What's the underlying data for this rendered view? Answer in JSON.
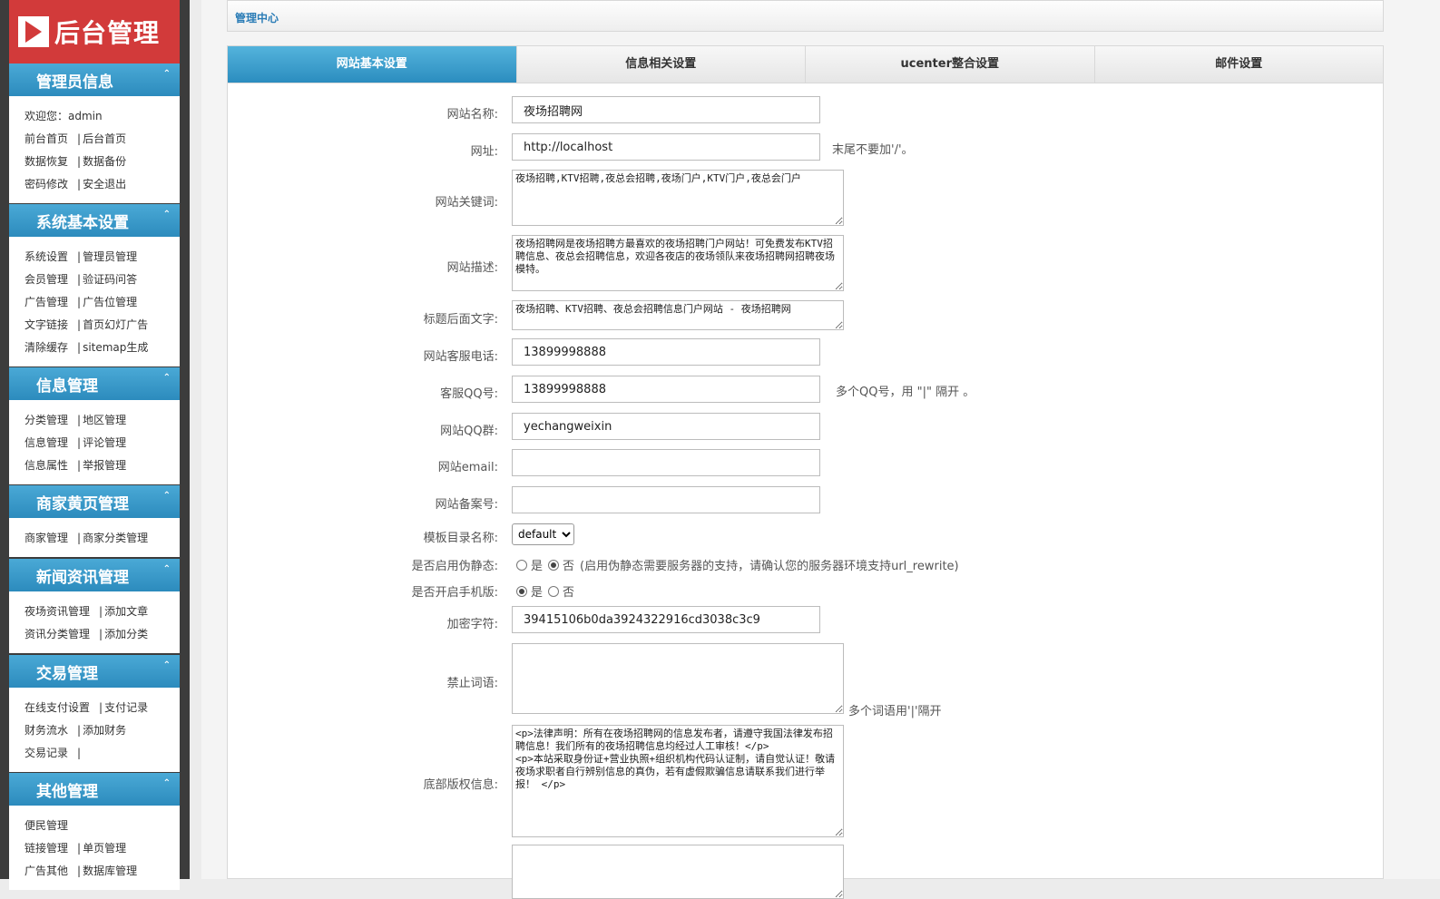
{
  "logo": {
    "text": "后台管理"
  },
  "sidebar": {
    "sections": [
      {
        "title": "管理员信息",
        "rows": [
          [
            "欢迎您：admin"
          ],
          [
            "前台首页",
            "后台首页"
          ],
          [
            "数据恢复",
            "数据备份"
          ],
          [
            "密码修改",
            "安全退出"
          ]
        ]
      },
      {
        "title": "系统基本设置",
        "rows": [
          [
            "系统设置",
            "管理员管理"
          ],
          [
            "会员管理",
            "验证码问答"
          ],
          [
            "广告管理",
            "广告位管理"
          ],
          [
            "文字链接",
            "首页幻灯广告"
          ],
          [
            "清除缓存",
            "sitemap生成"
          ]
        ]
      },
      {
        "title": "信息管理",
        "rows": [
          [
            "分类管理",
            "地区管理"
          ],
          [
            "信息管理",
            "评论管理"
          ],
          [
            "信息属性",
            "举报管理"
          ]
        ]
      },
      {
        "title": "商家黄页管理",
        "rows": [
          [
            "商家管理",
            "商家分类管理"
          ]
        ]
      },
      {
        "title": "新闻资讯管理",
        "rows": [
          [
            "夜场资讯管理",
            "添加文章"
          ],
          [
            "资讯分类管理",
            "添加分类"
          ]
        ]
      },
      {
        "title": "交易管理",
        "rows": [
          [
            "在线支付设置",
            "支付记录"
          ],
          [
            "财务流水",
            "添加财务"
          ],
          [
            "交易记录",
            ""
          ]
        ]
      },
      {
        "title": "其他管理",
        "rows": [
          [
            "便民管理"
          ],
          [
            "链接管理",
            "单页管理"
          ],
          [
            "广告其他",
            "数据库管理"
          ]
        ]
      }
    ]
  },
  "header": {
    "title": "管理中心"
  },
  "tabs": [
    {
      "label": "网站基本设置",
      "active": true
    },
    {
      "label": "信息相关设置",
      "active": false
    },
    {
      "label": "ucenter整合设置",
      "active": false
    },
    {
      "label": "邮件设置",
      "active": false
    }
  ],
  "form": {
    "site_name": {
      "label": "网站名称:",
      "value": "夜场招聘网"
    },
    "site_url": {
      "label": "网址:",
      "value": "http://localhost",
      "hint": "末尾不要加'/'。"
    },
    "keywords": {
      "label": "网站关键词:",
      "value": "夜场招聘,KTV招聘,夜总会招聘,夜场门户,KTV门户,夜总会门户"
    },
    "description": {
      "label": "网站描述:",
      "value": "夜场招聘网是夜场招聘方最喜欢的夜场招聘门户网站！可免费发布KTV招聘信息、夜总会招聘信息，欢迎各夜店的夜场领队来夜场招聘网招聘夜场模特。"
    },
    "title_suffix": {
      "label": "标题后面文字:",
      "value": "夜场招聘、KTV招聘、夜总会招聘信息门户网站 - 夜场招聘网"
    },
    "service_phone": {
      "label": "网站客服电话:",
      "value": "13899998888"
    },
    "service_qq": {
      "label": "客服QQ号:",
      "value": "13899998888",
      "hint": "多个QQ号，用 \"|\" 隔开 。"
    },
    "qq_group": {
      "label": "网站QQ群:",
      "value": "yechangweixin"
    },
    "email": {
      "label": "网站email:",
      "value": ""
    },
    "icp": {
      "label": "网站备案号:",
      "value": ""
    },
    "template": {
      "label": "模板目录名称:",
      "value": "default"
    },
    "rewrite": {
      "label": "是否启用伪静态:",
      "opt_yes": "是",
      "opt_no": "否",
      "selected": "no",
      "hint": "(启用伪静态需要服务器的支持，请确认您的服务器环境支持url_rewrite)"
    },
    "mobile": {
      "label": "是否开启手机版:",
      "opt_yes": "是",
      "opt_no": "否",
      "selected": "yes"
    },
    "secret": {
      "label": "加密字符:",
      "value": "39415106b0da3924322916cd3038c3c9"
    },
    "banned_words": {
      "label": "禁止词语:",
      "value": "",
      "hint": "多个词语用'|'隔开"
    },
    "copyright": {
      "label": "底部版权信息:",
      "value": "<p>法律声明：所有在夜场招聘网的信息发布者，请遵守我国法律发布招聘信息！我们所有的夜场招聘信息均经过人工审核！</p>\n<p>本站采取身份证+营业执照+组织机构代码认证制，请自觉认证！敬请夜场求职者自行辨别信息的真伪，若有虚假欺骗信息请联系我们进行举报！ </p>"
    }
  }
}
